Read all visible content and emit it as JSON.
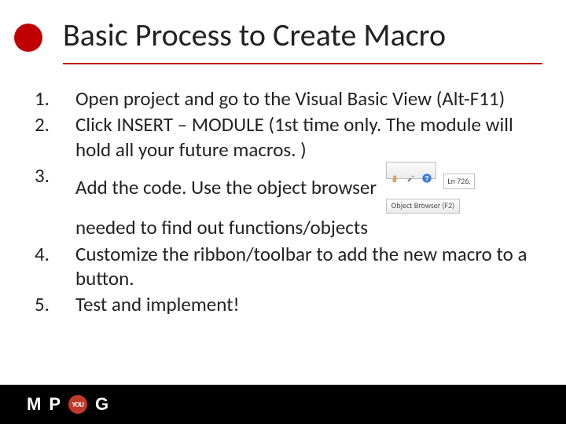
{
  "title": "Basic Process to Create Macro",
  "steps": {
    "s1": "Open project and go to the Visual Basic View (Alt-F11)",
    "s2": "Click INSERT – MODULE (1st time only. The module will hold all your future macros. )",
    "s3a": "Add the code. Use the object browser",
    "s3b": "needed to find out functions/objects",
    "s4": "Customize the ribbon/toolbar to add the new macro to a button.",
    "s5": "Test and implement!"
  },
  "toolbar": {
    "line_indicator": "Ln 726,",
    "object_browser_tip": "Object Browser (F2)"
  },
  "logo": {
    "m": "M",
    "p": "P",
    "o": "YOU",
    "g": "G"
  }
}
